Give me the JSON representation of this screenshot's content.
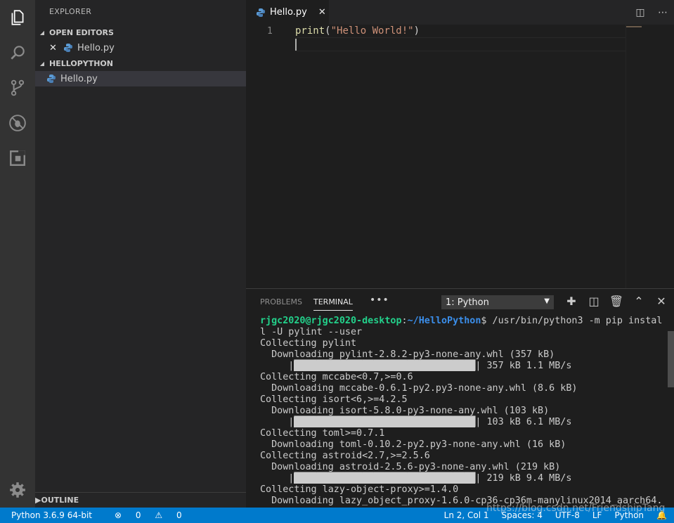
{
  "activity_bar": {
    "icons": [
      "files-icon",
      "search-icon",
      "source-control-icon",
      "debug-icon",
      "extensions-icon",
      "settings-gear-icon"
    ]
  },
  "sidebar": {
    "title": "EXPLORER",
    "open_editors": {
      "header": "OPEN EDITORS",
      "files": [
        "Hello.py"
      ]
    },
    "folder": {
      "header": "HELLOPYTHON",
      "files": [
        "Hello.py"
      ]
    },
    "outline_header": "OUTLINE"
  },
  "editor": {
    "tab_label": "Hello.py",
    "line_numbers": [
      "1"
    ],
    "code": {
      "fn": "print",
      "open": "(",
      "str": "\"Hello World!\"",
      "close": ")"
    }
  },
  "panel": {
    "tabs": [
      "PROBLEMS",
      "TERMINAL"
    ],
    "more": "•••",
    "terminal_select": "1: Python",
    "terminal": {
      "prompt_user": "rjgc2020@rjgc2020-desktop",
      "prompt_path": "~/HelloPython",
      "command": "$ /usr/bin/python3 -m pip instal",
      "command_wrap": "l -U pylint --user",
      "lines": [
        "Collecting pylint",
        "  Downloading pylint-2.8.2-py3-none-any.whl (357 kB)",
        "Collecting mccabe<0.7,>=0.6",
        "  Downloading mccabe-0.6.1-py2.py3-none-any.whl (8.6 kB)",
        "Collecting isort<6,>=4.2.5",
        "  Downloading isort-5.8.0-py3-none-any.whl (103 kB)",
        "Collecting toml>=0.7.1",
        "  Downloading toml-0.10.2-py2.py3-none-any.whl (16 kB)",
        "Collecting astroid<2.7,>=2.5.6",
        "  Downloading astroid-2.5.6-py3-none-any.whl (219 kB)",
        "Collecting lazy-object-proxy>=1.4.0",
        "  Downloading lazy_object_proxy-1.6.0-cp36-cp36m-manylinux2014_aarch64."
      ],
      "progress": [
        "357 kB 1.1 MB/s",
        "103 kB 6.1 MB/s",
        "219 kB 9.4 MB/s"
      ]
    }
  },
  "status_bar": {
    "python": "Python 3.6.9 64-bit",
    "errors": "0",
    "warnings": "0",
    "position": "Ln 2, Col 1",
    "spaces": "Spaces: 4",
    "encoding": "UTF-8",
    "eol": "LF",
    "language": "Python"
  },
  "watermark": "https://blog.csdn.net/FriendshipTang"
}
